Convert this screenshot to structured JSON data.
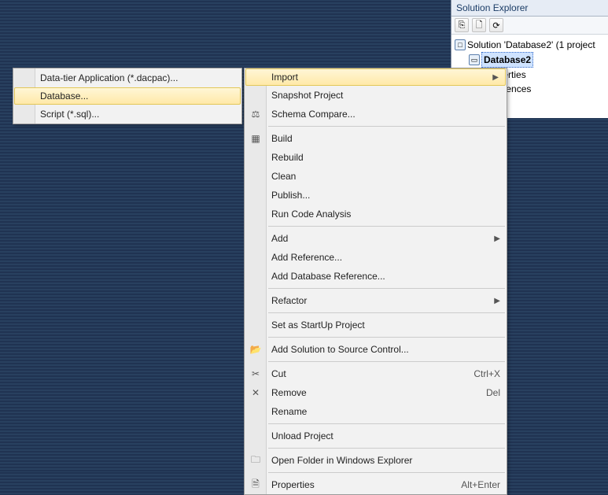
{
  "solution_explorer": {
    "title": "Solution Explorer",
    "toolbar_icons": [
      "copy-icon",
      "document-icon",
      "refresh-icon"
    ],
    "tree": {
      "solution_label": "Solution 'Database2' (1 project",
      "project_label": "Database2",
      "nodes": [
        {
          "label": "Properties"
        },
        {
          "label": "References"
        }
      ]
    }
  },
  "sub_menu": {
    "items": [
      {
        "label": "Data-tier Application (*.dacpac)...",
        "highlighted": false
      },
      {
        "label": "Database...",
        "highlighted": true
      },
      {
        "label": "Script (*.sql)...",
        "highlighted": false
      }
    ]
  },
  "main_menu": {
    "groups": [
      [
        {
          "label": "Import",
          "icon": "",
          "arrow": true,
          "highlighted": true
        },
        {
          "label": "Snapshot Project",
          "icon": ""
        },
        {
          "label": "Schema Compare...",
          "icon": "compare-icon"
        }
      ],
      [
        {
          "label": "Build",
          "icon": "build-icon"
        },
        {
          "label": "Rebuild",
          "icon": ""
        },
        {
          "label": "Clean",
          "icon": ""
        },
        {
          "label": "Publish...",
          "icon": ""
        },
        {
          "label": "Run Code Analysis",
          "icon": ""
        }
      ],
      [
        {
          "label": "Add",
          "icon": "",
          "arrow": true
        },
        {
          "label": "Add Reference...",
          "icon": ""
        },
        {
          "label": "Add Database Reference...",
          "icon": ""
        }
      ],
      [
        {
          "label": "Refactor",
          "icon": "",
          "arrow": true
        }
      ],
      [
        {
          "label": "Set as StartUp Project",
          "icon": ""
        }
      ],
      [
        {
          "label": "Add Solution to Source Control...",
          "icon": "folder-icon"
        }
      ],
      [
        {
          "label": "Cut",
          "icon": "cut-icon",
          "shortcut": "Ctrl+X"
        },
        {
          "label": "Remove",
          "icon": "remove-icon",
          "shortcut": "Del"
        },
        {
          "label": "Rename",
          "icon": ""
        }
      ],
      [
        {
          "label": "Unload Project",
          "icon": ""
        }
      ],
      [
        {
          "label": "Open Folder in Windows Explorer",
          "icon": "open-folder-icon"
        }
      ],
      [
        {
          "label": "Properties",
          "icon": "properties-icon",
          "shortcut": "Alt+Enter"
        }
      ]
    ]
  },
  "icons": {
    "compare-icon": "⚖",
    "build-icon": "▦",
    "folder-icon": "📂",
    "cut-icon": "✂",
    "remove-icon": "✕",
    "open-folder-icon": "🗀",
    "properties-icon": "🗎",
    "copy-icon": "⎘",
    "document-icon": "🗋",
    "refresh-icon": "⟳"
  }
}
